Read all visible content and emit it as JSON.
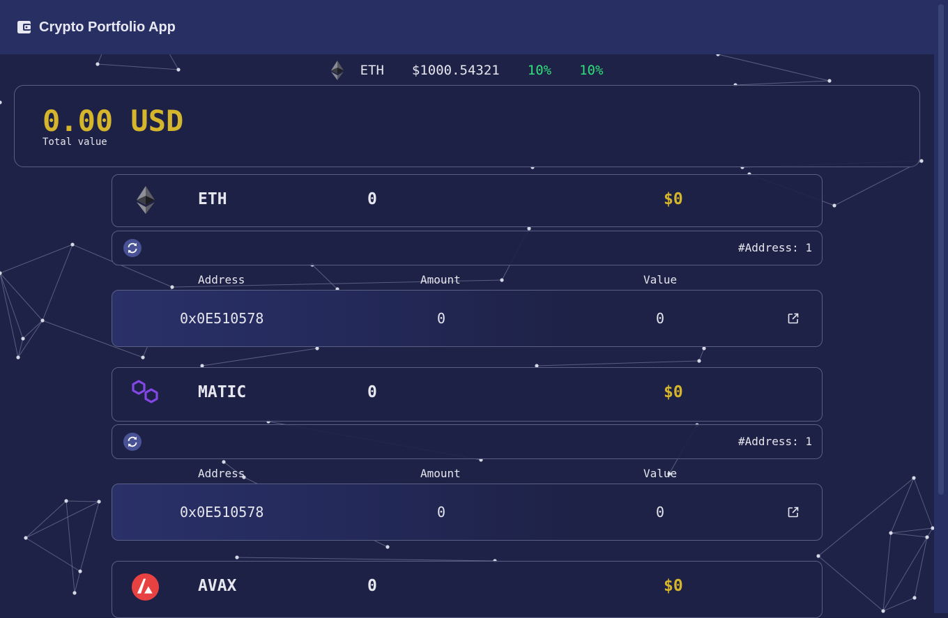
{
  "app": {
    "title": "Crypto Portfolio App"
  },
  "ticker": {
    "symbol": "ETH",
    "price": "$1000.54321",
    "change_1": "10%",
    "change_2": "10%",
    "icon": "eth-icon"
  },
  "total": {
    "amount": "0.00 USD",
    "label": "Total value"
  },
  "columns": {
    "address": "Address",
    "amount": "Amount",
    "value": "Value"
  },
  "coins": [
    {
      "symbol": "ETH",
      "amount": "0",
      "value": "$0",
      "icon": "eth-icon",
      "address_count": "#Address: 1",
      "addresses": [
        {
          "address": "0x0E510578",
          "amount": "0",
          "value": "0"
        }
      ]
    },
    {
      "symbol": "MATIC",
      "amount": "0",
      "value": "$0",
      "icon": "matic-icon",
      "address_count": "#Address: 1",
      "addresses": [
        {
          "address": "0x0E510578",
          "amount": "0",
          "value": "0"
        }
      ]
    },
    {
      "symbol": "AVAX",
      "amount": "0",
      "value": "$0",
      "icon": "avax-icon"
    }
  ],
  "colors": {
    "background": "#1e2247",
    "appbar": "#272f63",
    "accent_gold": "#d4b52c",
    "positive_green": "#2ee07a",
    "avax_red": "#e84142",
    "matic_purple": "#8247e5",
    "card_border": "#5a5f85"
  }
}
